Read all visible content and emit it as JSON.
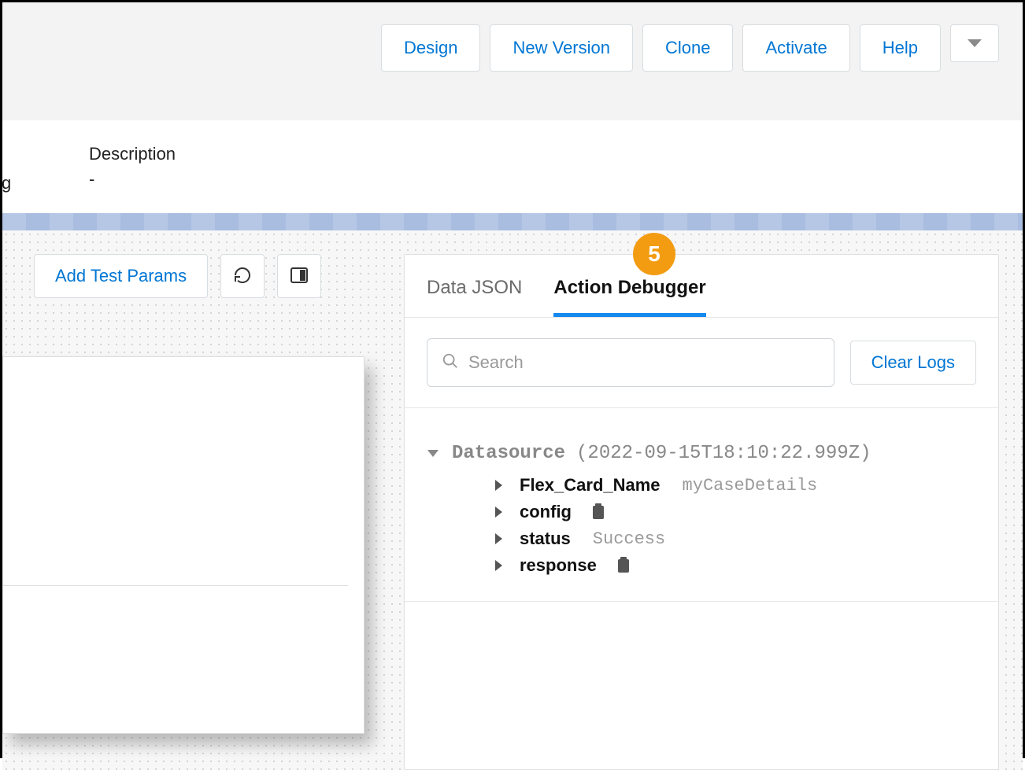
{
  "toolbar": {
    "design": "Design",
    "new_version": "New Version",
    "clone": "Clone",
    "activate": "Activate",
    "help": "Help"
  },
  "description": {
    "label": "Description",
    "value": "-",
    "clipped_text": "g"
  },
  "leftToolbar": {
    "add_test_params": "Add Test Params"
  },
  "callout": "5",
  "panel": {
    "tabs": {
      "data_json": "Data JSON",
      "action_debugger": "Action Debugger"
    },
    "search_placeholder": "Search",
    "clear_logs": "Clear Logs"
  },
  "tree": {
    "root_label": "Datasource",
    "root_timestamp": "(2022-09-15T18:10:22.999Z)",
    "children": [
      {
        "key": "Flex_Card_Name",
        "value": "myCaseDetails",
        "icon": "none",
        "expandable": true
      },
      {
        "key": "config",
        "value": "",
        "icon": "clipboard",
        "expandable": true
      },
      {
        "key": "status",
        "value": "Success",
        "icon": "none",
        "expandable": true
      },
      {
        "key": "response",
        "value": "",
        "icon": "clipboard",
        "expandable": true
      }
    ]
  }
}
